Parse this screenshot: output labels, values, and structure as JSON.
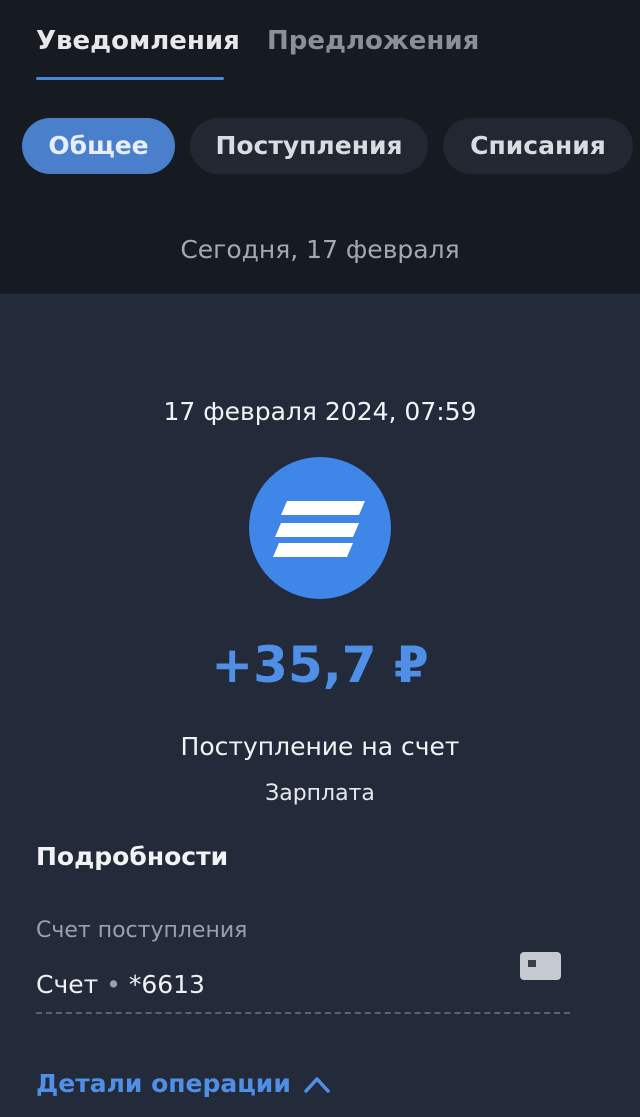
{
  "tabs": [
    {
      "label": "Уведомления",
      "active": true
    },
    {
      "label": "Предложения",
      "active": false
    }
  ],
  "filters": [
    {
      "label": "Общее",
      "selected": true
    },
    {
      "label": "Поступления",
      "selected": false
    },
    {
      "label": "Списания",
      "selected": false
    }
  ],
  "date_header": "Сегодня, 17 февраля",
  "operation": {
    "datetime": "17 февраля 2024, 07:59",
    "bank_icon": "bank-logo-icon",
    "amount": "+35,7 ₽",
    "type": "Поступление на счет",
    "category": "Зарплата"
  },
  "details": {
    "title": "Подробности",
    "account_label": "Счет поступления",
    "account_name": "Счет",
    "account_separator": "•",
    "account_number": "*6613",
    "card_icon": "card-icon",
    "more_link": "Детали операции",
    "more_icon": "chevron-up-icon"
  },
  "colors": {
    "accent": "#4f8fe6",
    "selected_chip": "#4a7fcb",
    "top_background": "#161a21",
    "card_background": "#232b3a",
    "logo_background": "#3f86e8"
  }
}
